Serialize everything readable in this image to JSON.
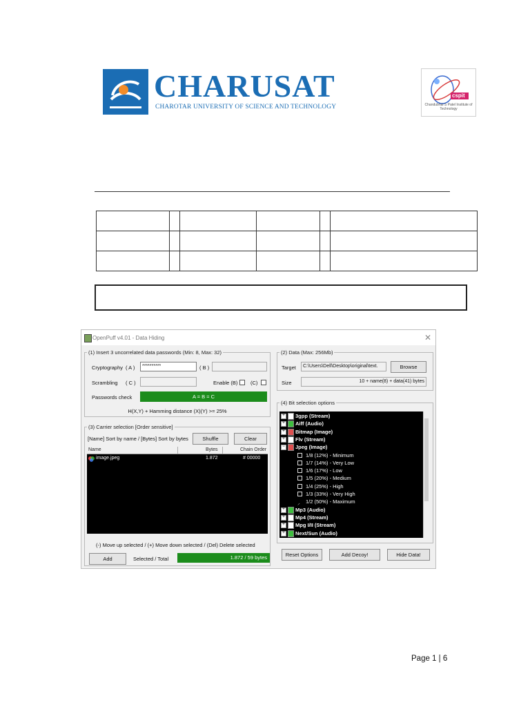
{
  "header": {
    "logo_title": "CHARUSAT",
    "logo_subtitle": "CHAROTAR UNIVERSITY OF SCIENCE AND TECHNOLOGY",
    "cspit_logo_text": "cspit",
    "cspit_caption": "Chandubhai S Patel Institute of Technology"
  },
  "window": {
    "title": "OpenPuff v4.01 - Data Hiding",
    "passwords": {
      "legend": "(1) Insert 3 uncorrelated data passwords (Min: 8, Max: 32)",
      "crypto_label": "Cryptography",
      "a_label": "( A )",
      "a_value": "**********",
      "b_label": "( B )",
      "scrambling_label": "Scrambling",
      "c_label": "( C )",
      "enable_b_label": "Enable (B)",
      "enable_c_label": "(C)",
      "check_label": "Passwords check",
      "check_value": "A = B = C",
      "hamming_text": "H(X,Y) + Hamming distance (X)(Y) >= 25%"
    },
    "carrier": {
      "legend": "(3) Carrier selection [Order sensitive]",
      "sort_text": "[Name] Sort by name / [Bytes] Sort by bytes",
      "shuffle": "Shuffle",
      "clear": "Clear",
      "columns": [
        "Name",
        "Bytes",
        "Chain Order"
      ],
      "rows": [
        {
          "name": "image.jpeg",
          "bytes": "1.872",
          "order": "# 00000"
        }
      ],
      "help_text": "(-) Move up selected / (+) Move down selected / (Del) Delete selected",
      "add": "Add",
      "selected_label": "Selected / Total",
      "selected_value": "1.872 / 59 bytes"
    },
    "data": {
      "legend": "(2) Data (Max: 256Mb)",
      "target_label": "Target",
      "target_value": "C:\\Users\\Dell\\Desktop\\original\\text.",
      "browse": "Browse",
      "size_label": "Size",
      "size_value": "10 + name(8) + data(41) bytes"
    },
    "bits": {
      "legend": "(4) Bit selection options",
      "items_top": [
        {
          "label": "3gpp (Stream)",
          "color": "#ffffff"
        },
        {
          "label": "Aiff (Audio)",
          "color": "#3fbf3f"
        },
        {
          "label": "Bitmap (Image)",
          "color": "#e05050"
        },
        {
          "label": "Flv (Stream)",
          "color": "#ffffff"
        },
        {
          "label": "Jpeg (Image)",
          "color": "#e05050"
        }
      ],
      "jpeg_options": [
        "1/8 (12%) - Minimum",
        "1/7 (14%) - Very Low",
        "1/6 (17%) - Low",
        "1/5 (20%) - Medium",
        "1/4 (25%) - High",
        "1/3 (33%) - Very High",
        "1/2 (50%) - Maximum"
      ],
      "items_bottom": [
        {
          "label": "Mp3 (Audio)",
          "color": "#3fbf3f"
        },
        {
          "label": "Mp4 (Stream)",
          "color": "#ffffff"
        },
        {
          "label": "Mpg I/II (Stream)",
          "color": "#ffffff"
        },
        {
          "label": "Next/Sun (Audio)",
          "color": "#3fbf3f"
        }
      ]
    },
    "buttons": {
      "reset": "Reset Options",
      "decoy": "Add Decoy!",
      "hide": "Hide Data!"
    }
  },
  "footer": {
    "page": "Page 1 | 6"
  }
}
